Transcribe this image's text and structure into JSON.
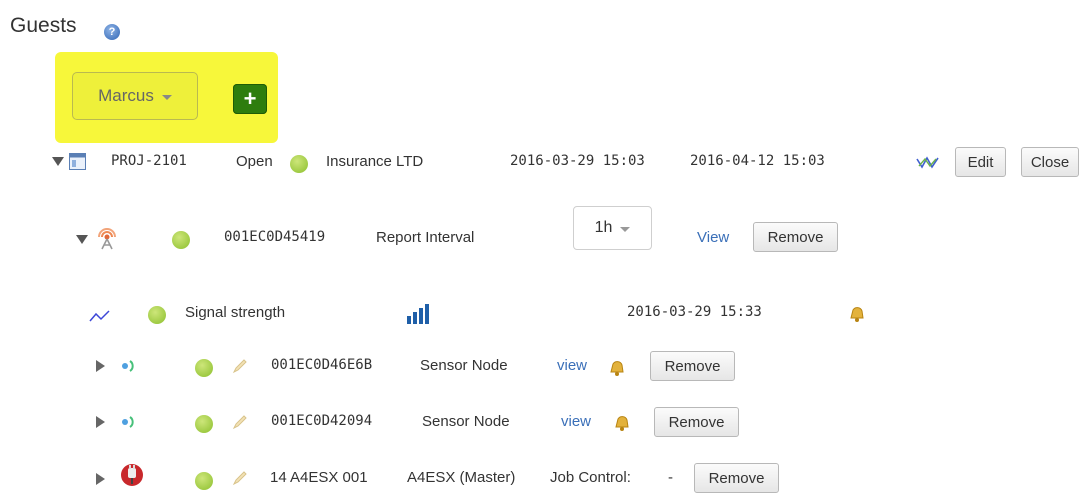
{
  "page": {
    "title": "Guests"
  },
  "toolbar": {
    "user_label": "Marcus",
    "add_label": "+"
  },
  "project": {
    "id": "PROJ-2101",
    "status": "Open",
    "customer": "Insurance LTD",
    "start": "2016-03-29 15:03",
    "end": "2016-04-12 15:03",
    "edit_label": "Edit",
    "close_label": "Close"
  },
  "gateway": {
    "id": "001EC0D45419",
    "interval_label": "Report Interval",
    "interval_value": "1h",
    "view_label": "View",
    "remove_label": "Remove"
  },
  "signal": {
    "label": "Signal strength",
    "time": "2016-03-29 15:33"
  },
  "nodes": [
    {
      "id": "001EC0D46E6B",
      "type": "Sensor Node",
      "view_label": "view",
      "remove_label": "Remove"
    },
    {
      "id": "001EC0D42094",
      "type": "Sensor Node",
      "view_label": "view",
      "remove_label": "Remove"
    }
  ],
  "a4esx": {
    "id": "14 A4ESX 001",
    "name": "A4ESX (Master)",
    "job_label": "Job Control:",
    "job_value": "-",
    "remove_label": "Remove"
  },
  "colors": {
    "highlight": "#f7f73a",
    "add_button": "#2e7d0e",
    "status_dot": "#8cbf2d",
    "link": "#3a6fb8"
  }
}
